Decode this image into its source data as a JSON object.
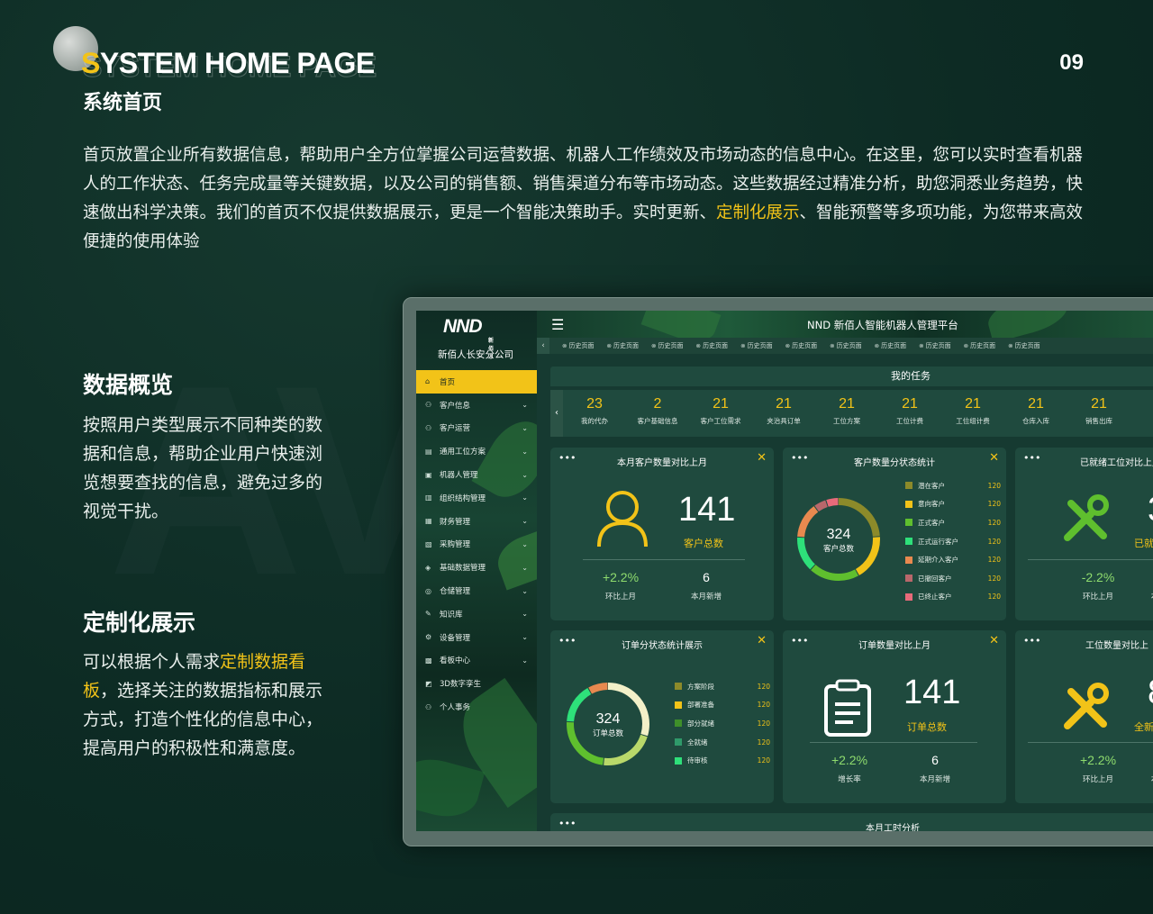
{
  "header": {
    "title_en_first": "S",
    "title_en_rest": "YSTEM HOME PAGE",
    "page_number": "09",
    "title_cn": "系统首页"
  },
  "intro": {
    "part1": "首页放置企业所有数据信息，帮助用户全方位掌握公司运营数据、机器人工作绩效及市场动态的信息中心。在这里，您可以实时查看机器人的工作状态、任务完成量等关键数据，以及公司的销售额、销售渠道分布等市场动态。这些数据经过精准分析，助您洞悉业务趋势，快速做出科学决策。我们的首页不仅提供数据展示，更是一个智能决策助手。实时更新、",
    "highlight": "定制化展示",
    "part2": "、智能预警等多项功能，为您带来高效便捷的使用体验"
  },
  "section1": {
    "heading": "数据概览",
    "text": "按照用户类型展示不同种类的数据和信息，帮助企业用户快速浏览想要查找的信息，避免过多的视觉干扰。"
  },
  "section2": {
    "heading": "定制化展示",
    "text_before": "可以根据个人需求",
    "highlight": "定制数据看板",
    "text_after": "，选择关注的数据指标和展示方式，打造个性化的信息中心，提高用户的积极性和满意度。"
  },
  "app": {
    "logo": "NND",
    "logo_sub": "新佰人",
    "company": "新佰人长安分公司",
    "platform_title": "NND 新佰人智能机器人管理平台",
    "menu": [
      {
        "label": "首页",
        "icon": "⌂",
        "active": true
      },
      {
        "label": "客户信息",
        "icon": "⚇"
      },
      {
        "label": "客户运营",
        "icon": "⚇"
      },
      {
        "label": "通用工位方案",
        "icon": "▤"
      },
      {
        "label": "机器人管理",
        "icon": "▣"
      },
      {
        "label": "组织结构管理",
        "icon": "▥"
      },
      {
        "label": "财务管理",
        "icon": "▦"
      },
      {
        "label": "采购管理",
        "icon": "▧"
      },
      {
        "label": "基础数据管理",
        "icon": "◈"
      },
      {
        "label": "仓储管理",
        "icon": "◎"
      },
      {
        "label": "知识库",
        "icon": "✎"
      },
      {
        "label": "设备管理",
        "icon": "⚙"
      },
      {
        "label": "看板中心",
        "icon": "▩"
      },
      {
        "label": "3D数字孪生",
        "icon": "◩"
      },
      {
        "label": "个人事务",
        "icon": "⚇"
      }
    ],
    "tabs": [
      "历史页面",
      "历史页面",
      "历史页面",
      "历史页面",
      "历史页面",
      "历史页面",
      "历史页面",
      "历史页面",
      "历史页面",
      "历史页面",
      "历史页面"
    ],
    "tasks_title": "我的任务",
    "tasks": [
      {
        "value": "23",
        "label": "我的代办"
      },
      {
        "value": "2",
        "label": "客户基础信息"
      },
      {
        "value": "21",
        "label": "客户工位需求"
      },
      {
        "value": "21",
        "label": "夹治具订单"
      },
      {
        "value": "21",
        "label": "工位方案"
      },
      {
        "value": "21",
        "label": "工位计费"
      },
      {
        "value": "21",
        "label": "工位组计费"
      },
      {
        "value": "21",
        "label": "仓库入库"
      },
      {
        "value": "21",
        "label": "销售出库"
      }
    ],
    "card1": {
      "title": "本月客户数量对比上月",
      "value": "141",
      "label": "客户总数",
      "stat1_value": "+2.2%",
      "stat1_label": "环比上月",
      "stat2_value": "6",
      "stat2_label": "本月新增"
    },
    "card2": {
      "title": "客户数量分状态统计",
      "center_value": "324",
      "center_label": "客户总数",
      "legend": [
        {
          "label": "潜在客户",
          "value": "120",
          "color": "#8c8a2a"
        },
        {
          "label": "意向客户",
          "value": "120",
          "color": "#f2c318"
        },
        {
          "label": "正式客户",
          "value": "120",
          "color": "#5fbf2e"
        },
        {
          "label": "正式运行客户",
          "value": "120",
          "color": "#2ee07a"
        },
        {
          "label": "延期介入客户",
          "value": "120",
          "color": "#e8894f"
        },
        {
          "label": "已撤回客户",
          "value": "120",
          "color": "#b9676b"
        },
        {
          "label": "已终止客户",
          "value": "120",
          "color": "#e86a7a"
        }
      ]
    },
    "card3": {
      "title": "已就绪工位对比上月",
      "value": "3",
      "label": "已就",
      "stat1_value": "-2.2%",
      "stat1_label": "环比上月",
      "stat2_label": "本"
    },
    "card4": {
      "title": "订单分状态统计展示",
      "center_value": "324",
      "center_label": "订单总数",
      "legend": [
        {
          "label": "方案阶段",
          "value": "120",
          "color": "#8c8a2a"
        },
        {
          "label": "部署准备",
          "value": "120",
          "color": "#f2c318"
        },
        {
          "label": "部分就绪",
          "value": "120",
          "color": "#3f8f2a"
        },
        {
          "label": "全就绪",
          "value": "120",
          "color": "#2f9a6a"
        },
        {
          "label": "待审核",
          "value": "120",
          "color": "#2ee07a"
        }
      ]
    },
    "card5": {
      "title": "订单数量对比上月",
      "value": "141",
      "label": "订单总数",
      "stat1_value": "+2.2%",
      "stat1_label": "增长率",
      "stat2_value": "6",
      "stat2_label": "本月新增"
    },
    "card6": {
      "title": "工位数量对比上",
      "value": "8",
      "label": "全新",
      "stat1_value": "+2.2%",
      "stat1_label": "环比上月",
      "stat2_label": "本"
    },
    "card7": {
      "title": "本月工时分析"
    }
  }
}
